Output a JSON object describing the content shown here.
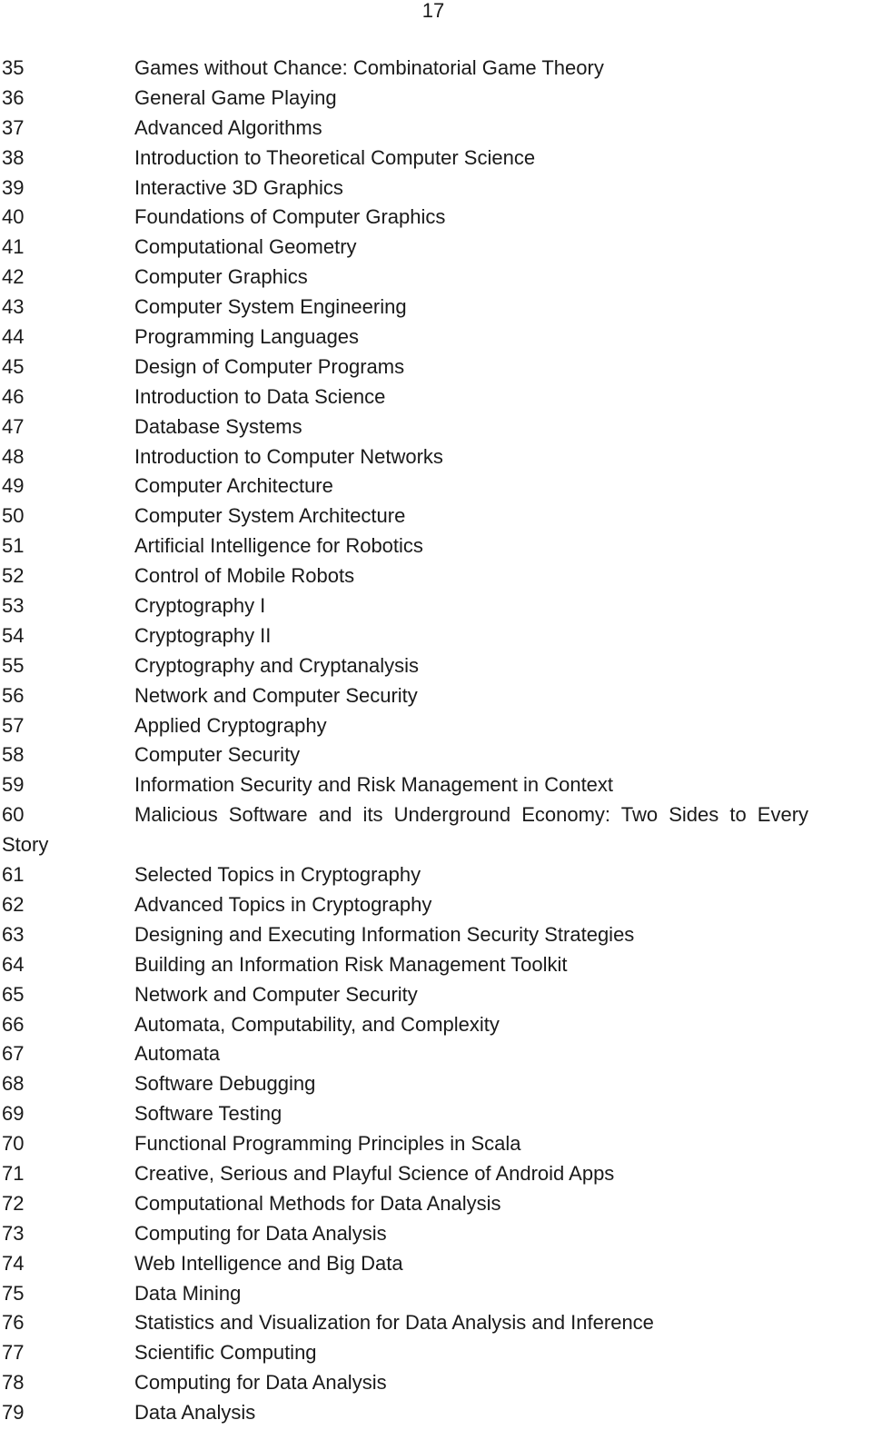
{
  "page_number": "17",
  "entries": [
    {
      "num": "35",
      "title": "Games without Chance: Combinatorial Game Theory"
    },
    {
      "num": "36",
      "title": "General Game Playing"
    },
    {
      "num": "37",
      "title": "Advanced Algorithms"
    },
    {
      "num": "38",
      "title": "Introduction to Theoretical Computer Science"
    },
    {
      "num": "39",
      "title": "Interactive 3D Graphics"
    },
    {
      "num": "40",
      "title": "Foundations of Computer Graphics"
    },
    {
      "num": "41",
      "title": "Computational Geometry"
    },
    {
      "num": "42",
      "title": "Computer Graphics"
    },
    {
      "num": "43",
      "title": "Computer System Engineering"
    },
    {
      "num": "44",
      "title": "Programming Languages"
    },
    {
      "num": "45",
      "title": "Design of Computer Programs"
    },
    {
      "num": "46",
      "title": "Introduction to Data Science"
    },
    {
      "num": "47",
      "title": "Database Systems"
    },
    {
      "num": "48",
      "title": "Introduction to Computer Networks"
    },
    {
      "num": "49",
      "title": "Computer Architecture"
    },
    {
      "num": "50",
      "title": "Computer System Architecture"
    },
    {
      "num": "51",
      "title": "Artificial Intelligence for Robotics"
    },
    {
      "num": "52",
      "title": "Control of Mobile Robots"
    },
    {
      "num": "53",
      "title": "Cryptography I"
    },
    {
      "num": "54",
      "title": "Cryptography II"
    },
    {
      "num": "55",
      "title": "Cryptography and Cryptanalysis"
    },
    {
      "num": "56",
      "title": "Network and Computer Security"
    },
    {
      "num": "57",
      "title": "Applied Cryptography"
    },
    {
      "num": "58",
      "title": "Computer Security"
    },
    {
      "num": "59",
      "title": "Information Security and Risk Management in Context"
    },
    {
      "num": "60",
      "title": "Malicious Software and its Underground Economy: Two Sides to Every",
      "continuation": "Story"
    },
    {
      "num": "61",
      "title": "Selected Topics in Cryptography"
    },
    {
      "num": "62",
      "title": "Advanced Topics in Cryptography"
    },
    {
      "num": "63",
      "title": "Designing and Executing Information Security Strategies"
    },
    {
      "num": "64",
      "title": "Building an Information Risk Management Toolkit"
    },
    {
      "num": "65",
      "title": "Network and Computer Security"
    },
    {
      "num": "66",
      "title": "Automata, Computability, and Complexity"
    },
    {
      "num": "67",
      "title": "Automata"
    },
    {
      "num": "68",
      "title": "Software Debugging"
    },
    {
      "num": "69",
      "title": "Software Testing"
    },
    {
      "num": "70",
      "title": "Functional Programming Principles in Scala"
    },
    {
      "num": "71",
      "title": "Creative, Serious and Playful Science of Android Apps"
    },
    {
      "num": "72",
      "title": "Computational Methods for Data Analysis"
    },
    {
      "num": "73",
      "title": "Computing for Data Analysis"
    },
    {
      "num": "74",
      "title": "Web Intelligence and Big Data"
    },
    {
      "num": "75",
      "title": "Data Mining"
    },
    {
      "num": "76",
      "title": "Statistics and Visualization for Data Analysis and Inference"
    },
    {
      "num": "77",
      "title": "Scientific Computing"
    },
    {
      "num": "78",
      "title": "Computing for Data Analysis"
    },
    {
      "num": "79",
      "title": "Data Analysis"
    }
  ]
}
